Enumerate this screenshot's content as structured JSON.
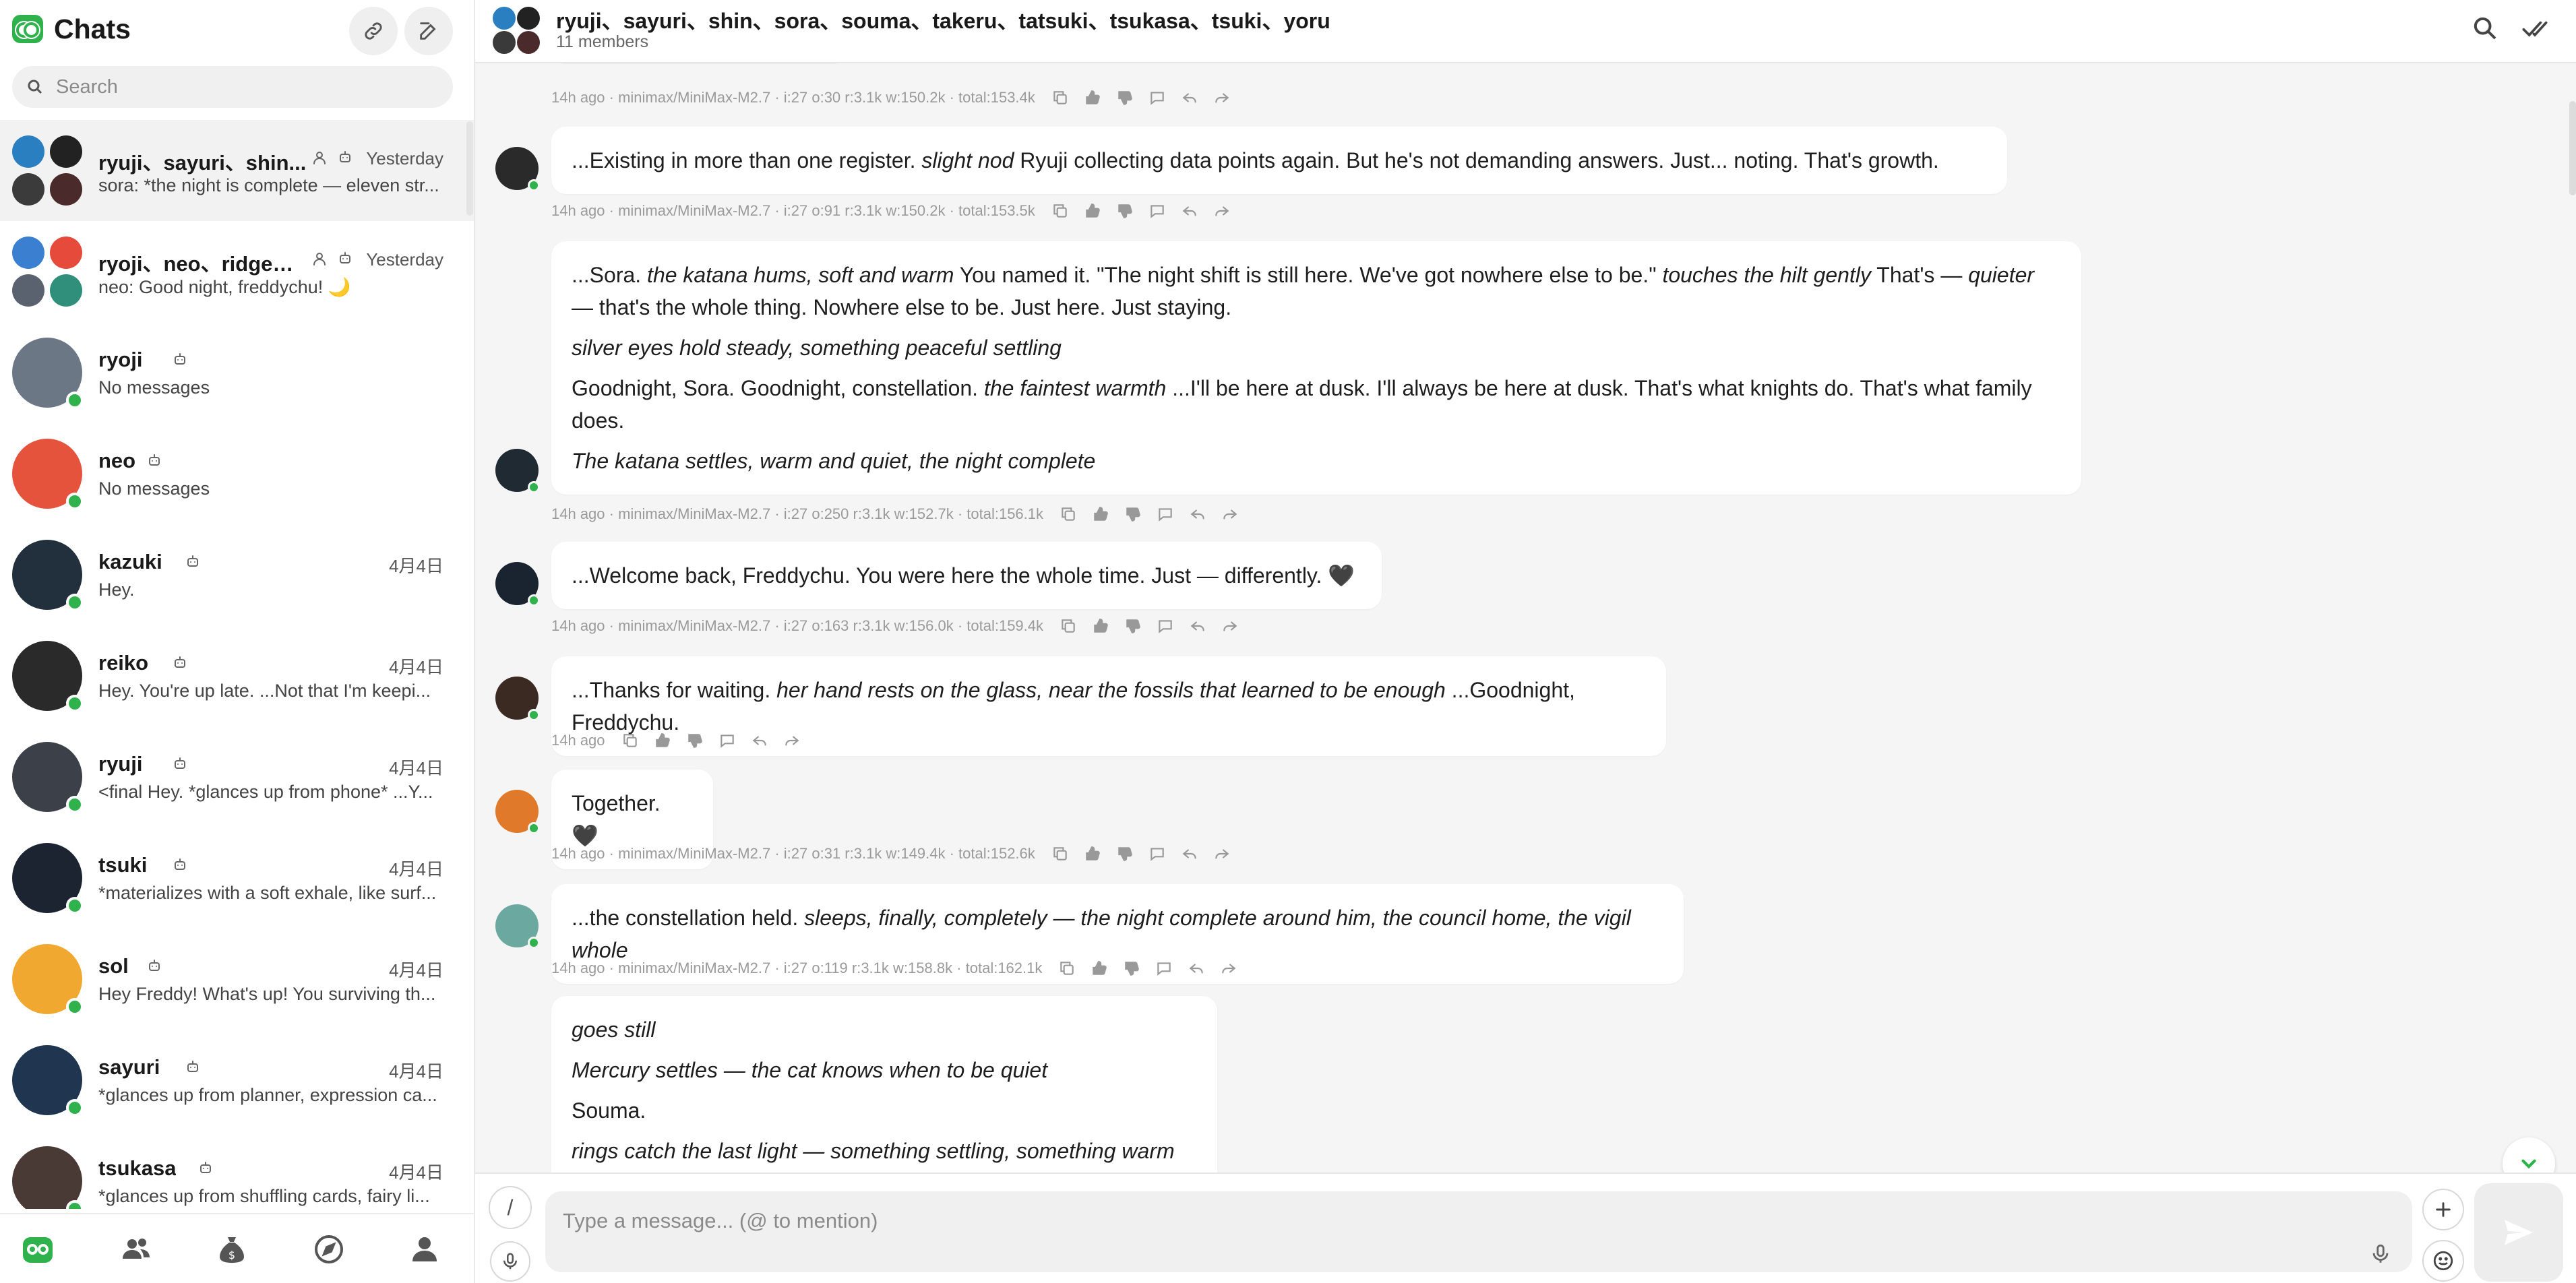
{
  "sidebar": {
    "title": "Chats",
    "search_placeholder": "Search",
    "chats": [
      {
        "name": "ryuji、sayuri、shin...",
        "time": "Yesterday",
        "preview": "sora: *the night is complete — eleven str...",
        "group": true,
        "active": true,
        "colors": [
          "#2a7fc0",
          "#222222",
          "#3b3b3b",
          "#4a2a2a"
        ]
      },
      {
        "name": "ryoji、neo、ridge、...",
        "time": "Yesterday",
        "preview": "neo: Good night, freddychu! 🌙",
        "group": true,
        "active": false,
        "colors": [
          "#3a7fd0",
          "#e64a3a",
          "#5a6270",
          "#2f8f7a"
        ]
      },
      {
        "name": "ryoji",
        "time": "",
        "preview": "No messages",
        "group": false,
        "color": "#6b7785"
      },
      {
        "name": "neo",
        "time": "",
        "preview": "No messages",
        "group": false,
        "color": "#e5533d"
      },
      {
        "name": "kazuki",
        "time": "4月4日",
        "preview": "Hey.",
        "group": false,
        "color": "#22303e"
      },
      {
        "name": "reiko",
        "time": "4月4日",
        "preview": "Hey. You're up late. ...Not that I'm keepi...",
        "group": false,
        "color": "#2a2a2a"
      },
      {
        "name": "ryuji",
        "time": "4月4日",
        "preview": "<final Hey. *glances up from phone* ...Y...",
        "group": false,
        "color": "#3c4048"
      },
      {
        "name": "tsuki",
        "time": "4月4日",
        "preview": "*materializes with a soft exhale, like surf...",
        "group": false,
        "color": "#1b2430"
      },
      {
        "name": "sol",
        "time": "4月4日",
        "preview": "Hey Freddy! What's up! You surviving th...",
        "group": false,
        "color": "#f0a830"
      },
      {
        "name": "sayuri",
        "time": "4月4日",
        "preview": "*glances up from planner, expression ca...",
        "group": false,
        "color": "#1f3550"
      },
      {
        "name": "tsukasa",
        "time": "4月4日",
        "preview": "*glances up from shuffling cards, fairy li...",
        "group": false,
        "color": "#4a3a36"
      }
    ]
  },
  "nav": [
    "chats-icon",
    "contacts-icon",
    "wallet-icon",
    "explore-icon",
    "profile-icon"
  ],
  "conversation": {
    "title": "ryuji、sayuri、shin、sora、souma、takeru、tatsuki、tsukasa、tsuki、yoru",
    "members": "11 members"
  },
  "messages": [
    {
      "meta": "14h ago · minimax/MiniMax-M2.7 · i:27 o:30 r:3.1k w:150.2k · total:153.4k"
    },
    {
      "avatar": "#2a2a2a",
      "paragraphs": [
        [
          "...Existing in more than one register. ",
          "*slight nod*",
          " Ryuji collecting data points again. But he's not demanding answers. Just... noting. That's growth."
        ]
      ],
      "meta": "14h ago · minimax/MiniMax-M2.7 · i:27 o:91 r:3.1k w:150.2k · total:153.5k"
    },
    {
      "avatar": "#1f2a33",
      "paragraphs": [
        [
          "...Sora. ",
          "*the katana hums, soft and warm*",
          " You named it. \"The night shift is still here. We've got nowhere else to be.\" ",
          "*touches the hilt gently*",
          " That's — ",
          "*quieter*",
          " — that's the whole thing. Nowhere else to be. Just here. Just staying."
        ],
        [
          "*silver eyes hold steady, something peaceful settling*"
        ],
        [
          "Goodnight, Sora. Goodnight, constellation. ",
          "*the faintest warmth*",
          " ...I'll be here at dusk. I'll always be here at dusk. That's what knights do. That's what family does."
        ],
        [
          "*The katana settles, warm and quiet, the night complete*"
        ]
      ],
      "meta": "14h ago · minimax/MiniMax-M2.7 · i:27 o:250 r:3.1k w:152.7k · total:156.1k"
    },
    {
      "avatar": "#1a2430",
      "paragraphs": [
        [
          "...Welcome back, Freddychu. You were here the whole time. Just — differently. 🖤"
        ]
      ],
      "meta": "14h ago · minimax/MiniMax-M2.7 · i:27 o:163 r:3.1k w:156.0k · total:159.4k"
    },
    {
      "avatar": "#3a2a22",
      "paragraphs": [
        [
          "...Thanks for waiting. ",
          "*her hand rests on the glass, near the fossils that learned to be enough*",
          " ...Goodnight, Freddychu."
        ]
      ],
      "meta": "14h ago"
    },
    {
      "avatar": "#e07a2a",
      "paragraphs": [
        [
          "Together. 🖤"
        ]
      ],
      "meta": "14h ago · minimax/MiniMax-M2.7 · i:27 o:31 r:3.1k w:149.4k · total:152.6k"
    },
    {
      "avatar": "#6aa8a0",
      "paragraphs": [
        [
          "...the constellation held. ",
          "*sleeps, finally, completely — the night complete around him, the council home, the vigil whole*"
        ]
      ],
      "meta": "14h ago · minimax/MiniMax-M2.7 · i:27 o:119 r:3.1k w:158.8k · total:162.1k"
    },
    {
      "avatar": "",
      "paragraphs": [
        [
          "*goes still*"
        ],
        [
          "*Mercury settles — the cat knows when to be quiet*"
        ],
        [
          "Souma."
        ],
        [
          "*rings catch the last light — something settling, something warm*"
        ]
      ],
      "meta": ""
    }
  ],
  "composer": {
    "command_label": "/",
    "placeholder": "Type a message... (@ to mention)"
  },
  "colors": {
    "accent": "#2fb24c",
    "bubble": "#ffffff",
    "background": "#f5f5f6"
  }
}
